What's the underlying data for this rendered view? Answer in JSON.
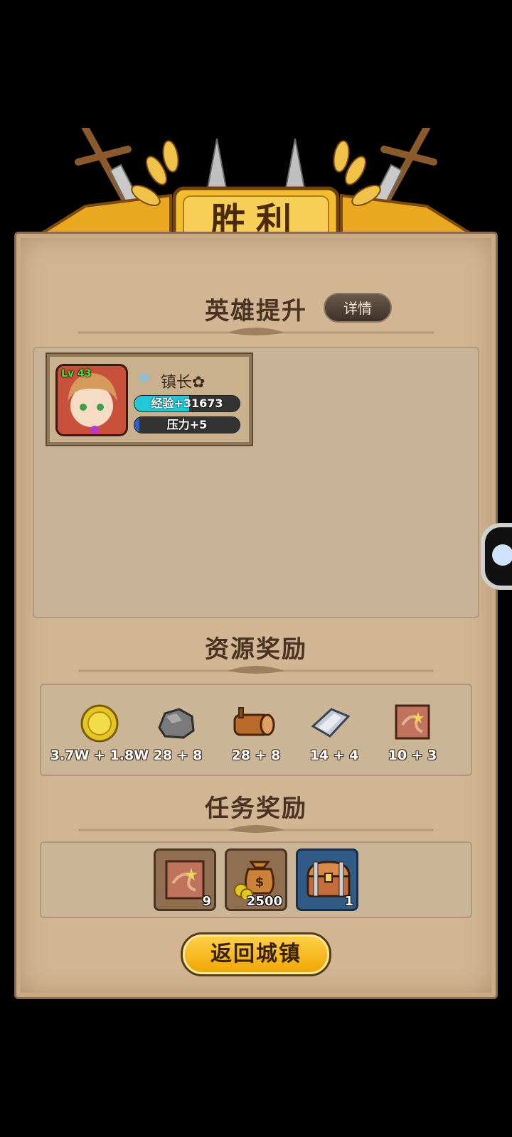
{
  "banner": {
    "title": "胜利"
  },
  "hero_section": {
    "title": "英雄提升",
    "details_button": "详情"
  },
  "hero": {
    "level": "Lv 43",
    "name": "镇长",
    "name_suffix": "✿",
    "exp_label": "经验+31673",
    "exp_fill": 0.52,
    "pressure_label": "压力+5",
    "pressure_fill": 0.05,
    "colors": {
      "exp_bar": "#20c8d8",
      "pressure_bar": "#2b5fd1"
    }
  },
  "resource_section": {
    "title": "资源奖励",
    "items": [
      {
        "icon": "gold-coin-icon",
        "label": "3.7W + 1.8W"
      },
      {
        "icon": "stone-ore-icon",
        "label": "28 + 8"
      },
      {
        "icon": "wood-log-icon",
        "label": "28 + 8"
      },
      {
        "icon": "iron-ingot-icon",
        "label": "14 + 4"
      },
      {
        "icon": "cloth-scroll-icon",
        "label": "10 + 3"
      }
    ]
  },
  "task_section": {
    "title": "任务奖励",
    "items": [
      {
        "icon": "cloth-scroll-icon",
        "count": "9"
      },
      {
        "icon": "money-bag-icon",
        "count": "2500"
      },
      {
        "icon": "treasure-chest-icon",
        "count": "1"
      }
    ]
  },
  "return_button": "返回城镇"
}
